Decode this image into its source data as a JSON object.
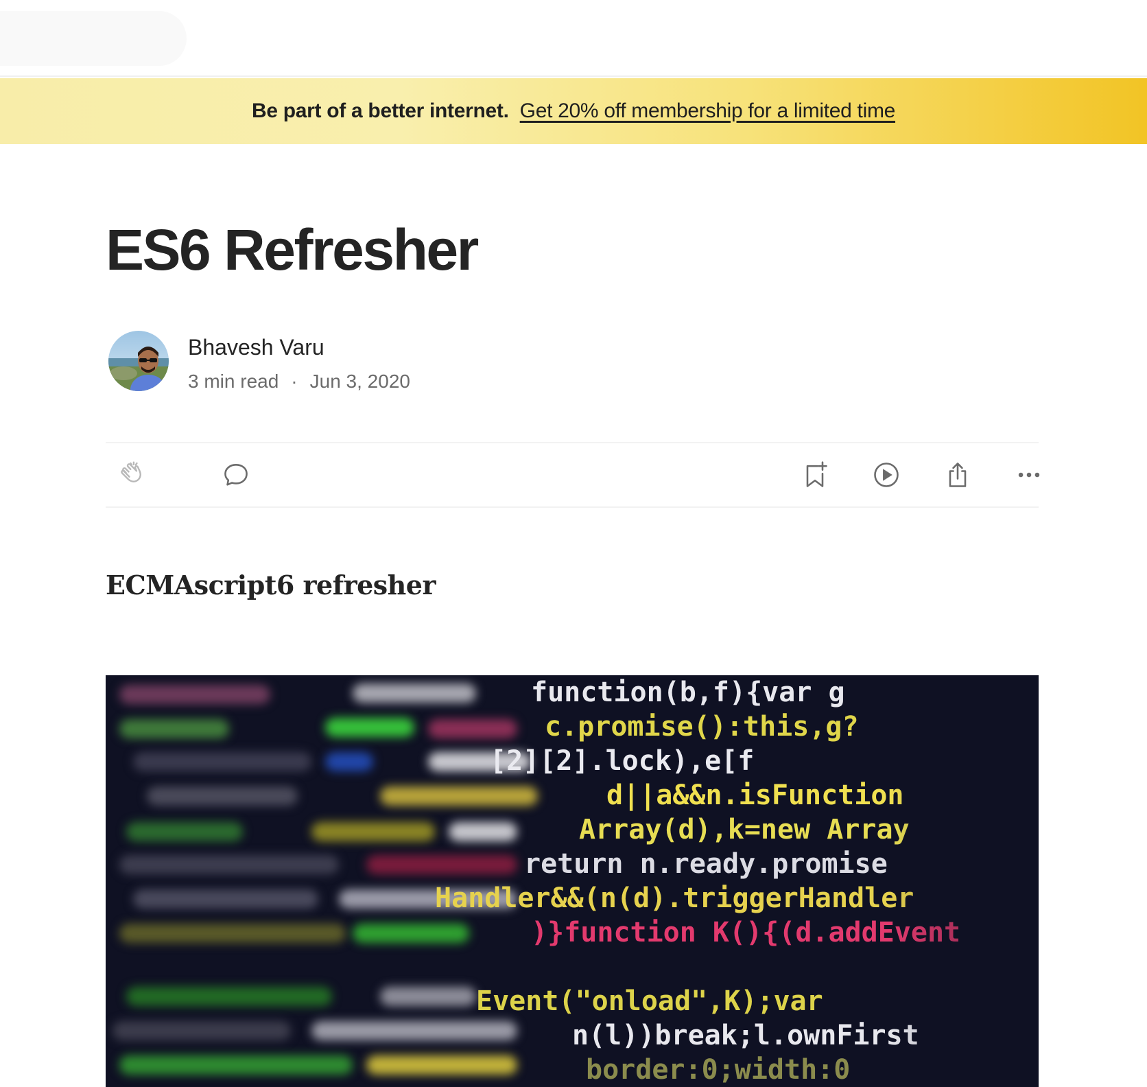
{
  "promo": {
    "lead": "Be part of a better internet.",
    "link": "Get 20% off membership for a limited time"
  },
  "article": {
    "title": "ES6 Refresher",
    "author": "Bhavesh Varu",
    "read_time": "3 min read",
    "separator": "·",
    "date": "Jun 3, 2020",
    "subtitle": "ECMAscript6 refresher"
  },
  "actions": {
    "icons": [
      "clap-icon",
      "comment-icon",
      "bookmark-icon",
      "play-icon",
      "share-icon",
      "more-icon"
    ]
  },
  "hero_code": [
    "function(b,f){var g",
    "c.promise():this,g?",
    "[2][2].lock),e[f",
    "d||a&&n.isFunction",
    "Array(d),k=new Array",
    "return n.ready.promise",
    "Handler&&(n(d).triggerHandler",
    ")}function K(){(d.addEvent",
    "Event(\"onload\",K);var",
    "n(l))break;l.ownFirst",
    "border:0;width:0"
  ],
  "colors": {
    "banner_start": "#f8eda9",
    "banner_end": "#f2c425",
    "text_primary": "#242424",
    "text_secondary": "#6b6b6b",
    "hero_bg": "#0f1123"
  }
}
